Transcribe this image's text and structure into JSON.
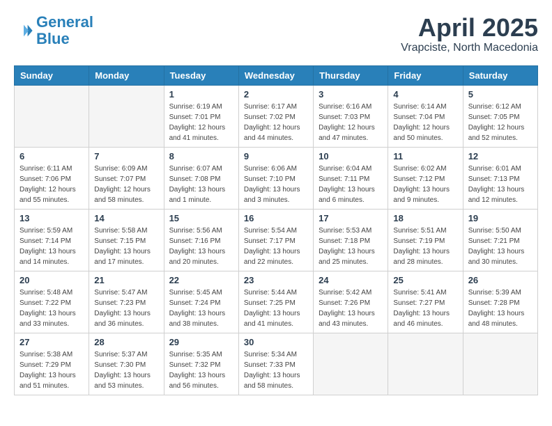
{
  "header": {
    "logo_general": "General",
    "logo_blue": "Blue",
    "month_title": "April 2025",
    "location": "Vrapciste, North Macedonia"
  },
  "days_of_week": [
    "Sunday",
    "Monday",
    "Tuesday",
    "Wednesday",
    "Thursday",
    "Friday",
    "Saturday"
  ],
  "weeks": [
    [
      {
        "day": "",
        "info": ""
      },
      {
        "day": "",
        "info": ""
      },
      {
        "day": "1",
        "info": "Sunrise: 6:19 AM\nSunset: 7:01 PM\nDaylight: 12 hours\nand 41 minutes."
      },
      {
        "day": "2",
        "info": "Sunrise: 6:17 AM\nSunset: 7:02 PM\nDaylight: 12 hours\nand 44 minutes."
      },
      {
        "day": "3",
        "info": "Sunrise: 6:16 AM\nSunset: 7:03 PM\nDaylight: 12 hours\nand 47 minutes."
      },
      {
        "day": "4",
        "info": "Sunrise: 6:14 AM\nSunset: 7:04 PM\nDaylight: 12 hours\nand 50 minutes."
      },
      {
        "day": "5",
        "info": "Sunrise: 6:12 AM\nSunset: 7:05 PM\nDaylight: 12 hours\nand 52 minutes."
      }
    ],
    [
      {
        "day": "6",
        "info": "Sunrise: 6:11 AM\nSunset: 7:06 PM\nDaylight: 12 hours\nand 55 minutes."
      },
      {
        "day": "7",
        "info": "Sunrise: 6:09 AM\nSunset: 7:07 PM\nDaylight: 12 hours\nand 58 minutes."
      },
      {
        "day": "8",
        "info": "Sunrise: 6:07 AM\nSunset: 7:08 PM\nDaylight: 13 hours\nand 1 minute."
      },
      {
        "day": "9",
        "info": "Sunrise: 6:06 AM\nSunset: 7:10 PM\nDaylight: 13 hours\nand 3 minutes."
      },
      {
        "day": "10",
        "info": "Sunrise: 6:04 AM\nSunset: 7:11 PM\nDaylight: 13 hours\nand 6 minutes."
      },
      {
        "day": "11",
        "info": "Sunrise: 6:02 AM\nSunset: 7:12 PM\nDaylight: 13 hours\nand 9 minutes."
      },
      {
        "day": "12",
        "info": "Sunrise: 6:01 AM\nSunset: 7:13 PM\nDaylight: 13 hours\nand 12 minutes."
      }
    ],
    [
      {
        "day": "13",
        "info": "Sunrise: 5:59 AM\nSunset: 7:14 PM\nDaylight: 13 hours\nand 14 minutes."
      },
      {
        "day": "14",
        "info": "Sunrise: 5:58 AM\nSunset: 7:15 PM\nDaylight: 13 hours\nand 17 minutes."
      },
      {
        "day": "15",
        "info": "Sunrise: 5:56 AM\nSunset: 7:16 PM\nDaylight: 13 hours\nand 20 minutes."
      },
      {
        "day": "16",
        "info": "Sunrise: 5:54 AM\nSunset: 7:17 PM\nDaylight: 13 hours\nand 22 minutes."
      },
      {
        "day": "17",
        "info": "Sunrise: 5:53 AM\nSunset: 7:18 PM\nDaylight: 13 hours\nand 25 minutes."
      },
      {
        "day": "18",
        "info": "Sunrise: 5:51 AM\nSunset: 7:19 PM\nDaylight: 13 hours\nand 28 minutes."
      },
      {
        "day": "19",
        "info": "Sunrise: 5:50 AM\nSunset: 7:21 PM\nDaylight: 13 hours\nand 30 minutes."
      }
    ],
    [
      {
        "day": "20",
        "info": "Sunrise: 5:48 AM\nSunset: 7:22 PM\nDaylight: 13 hours\nand 33 minutes."
      },
      {
        "day": "21",
        "info": "Sunrise: 5:47 AM\nSunset: 7:23 PM\nDaylight: 13 hours\nand 36 minutes."
      },
      {
        "day": "22",
        "info": "Sunrise: 5:45 AM\nSunset: 7:24 PM\nDaylight: 13 hours\nand 38 minutes."
      },
      {
        "day": "23",
        "info": "Sunrise: 5:44 AM\nSunset: 7:25 PM\nDaylight: 13 hours\nand 41 minutes."
      },
      {
        "day": "24",
        "info": "Sunrise: 5:42 AM\nSunset: 7:26 PM\nDaylight: 13 hours\nand 43 minutes."
      },
      {
        "day": "25",
        "info": "Sunrise: 5:41 AM\nSunset: 7:27 PM\nDaylight: 13 hours\nand 46 minutes."
      },
      {
        "day": "26",
        "info": "Sunrise: 5:39 AM\nSunset: 7:28 PM\nDaylight: 13 hours\nand 48 minutes."
      }
    ],
    [
      {
        "day": "27",
        "info": "Sunrise: 5:38 AM\nSunset: 7:29 PM\nDaylight: 13 hours\nand 51 minutes."
      },
      {
        "day": "28",
        "info": "Sunrise: 5:37 AM\nSunset: 7:30 PM\nDaylight: 13 hours\nand 53 minutes."
      },
      {
        "day": "29",
        "info": "Sunrise: 5:35 AM\nSunset: 7:32 PM\nDaylight: 13 hours\nand 56 minutes."
      },
      {
        "day": "30",
        "info": "Sunrise: 5:34 AM\nSunset: 7:33 PM\nDaylight: 13 hours\nand 58 minutes."
      },
      {
        "day": "",
        "info": ""
      },
      {
        "day": "",
        "info": ""
      },
      {
        "day": "",
        "info": ""
      }
    ]
  ]
}
